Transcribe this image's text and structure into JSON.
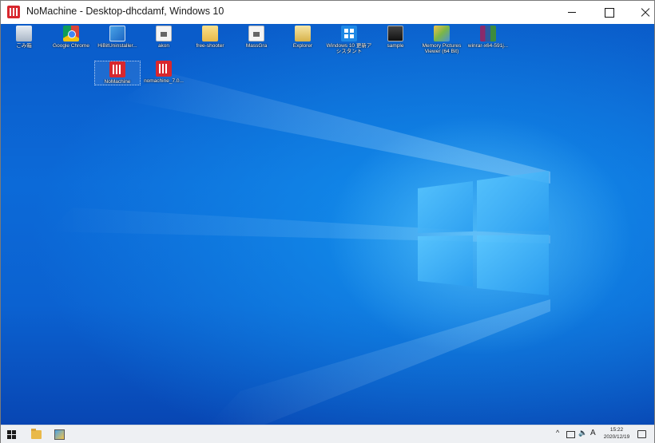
{
  "window": {
    "title": "NoMachine - Desktop-dhcdamf, Windows 10",
    "app_icon": "nomachine-icon",
    "controls": [
      "minimize-icon",
      "maximize-icon",
      "close-icon"
    ]
  },
  "desktop": {
    "wallpaper": "windows-10-hero",
    "colors": {
      "wallpaper_dark": "#0846b3",
      "wallpaper_light": "#78d7ff"
    },
    "icons": [
      {
        "label": "ごみ箱",
        "icon": "recycle-bin-icon"
      },
      {
        "label": "Google Chrome",
        "icon": "chrome-icon"
      },
      {
        "label": "HiBitUninstaller...",
        "icon": "uninstaller-icon"
      },
      {
        "label": "akon",
        "icon": "file-icon"
      },
      {
        "label": "free-shooter",
        "icon": "folder-icon"
      },
      {
        "label": "MassGra",
        "icon": "file-icon"
      },
      {
        "label": "Explorer",
        "icon": "explorer-icon"
      },
      {
        "label": "Windows 10 更新アシスタント",
        "icon": "windows-icon"
      },
      {
        "label": "sample",
        "icon": "sample-icon"
      },
      {
        "label": "Memory Pictures Viewer (64 Bit)",
        "icon": "picture-viewer-icon"
      },
      {
        "label": "winrar-x64-591j...",
        "icon": "winrar-icon"
      },
      {
        "label": "NoMachine",
        "icon": "nomachine-icon"
      },
      {
        "label": "nomachine_7.0...",
        "icon": "nomachine-icon"
      }
    ]
  },
  "taskbar": {
    "start": "windows-start-icon",
    "pinned": [
      "file-explorer-icon",
      "app-icon"
    ],
    "tray": {
      "ime": "A",
      "chevron": "^"
    },
    "clock": {
      "time": "15:22",
      "date": "2020/12/19"
    }
  }
}
